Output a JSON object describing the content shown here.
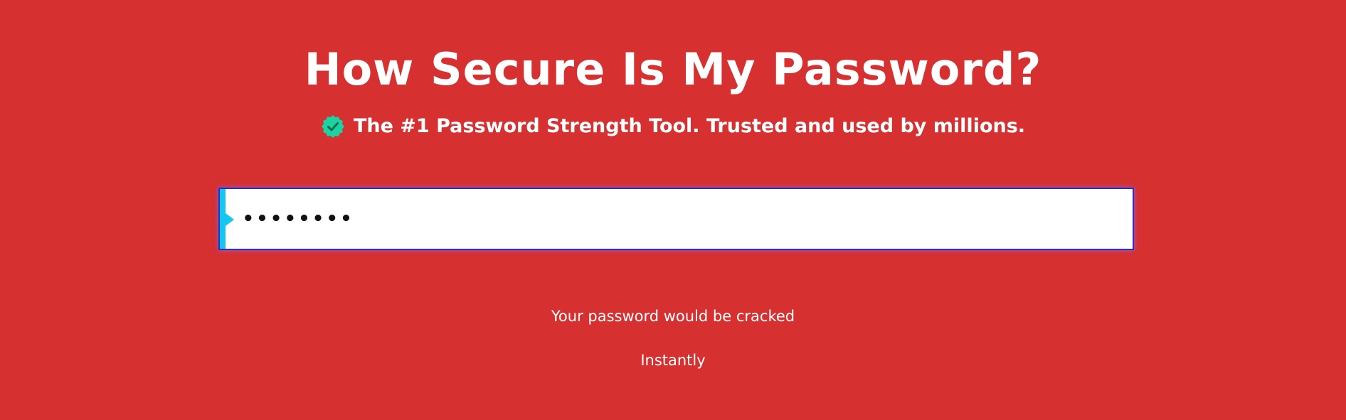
{
  "header": {
    "title": "How Secure Is My Password?",
    "subtitle": "The #1 Password Strength Tool. Trusted and used by millions.",
    "subtitle_icon": "verified-check-icon"
  },
  "password_field": {
    "value": "password",
    "type": "password"
  },
  "result": {
    "label": "Your password would be cracked",
    "value": "Instantly"
  },
  "colors": {
    "background": "#d63031",
    "verified_badge": "#1dd1a1",
    "input_accent": "#12c8f0",
    "input_border": "#2b2bd6"
  }
}
